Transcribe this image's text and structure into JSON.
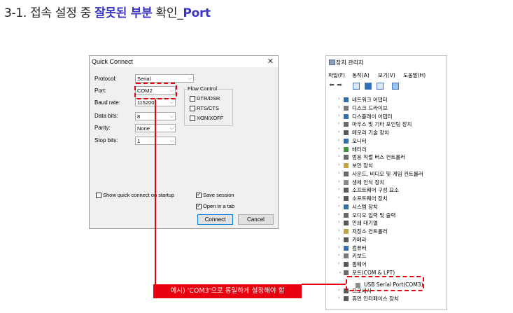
{
  "slide": {
    "title_prefix": "3-1. 접속 설정 중 ",
    "title_highlight": "잘못된 부분",
    "title_mid": " 확인_",
    "title_port": "Port"
  },
  "quick_connect": {
    "title": "Quick Connect",
    "close": "✕",
    "fields": [
      {
        "label": "Protocol:",
        "value": "Serial"
      },
      {
        "label": "Port:",
        "value": "COM2"
      },
      {
        "label": "Baud rate:",
        "value": "115200"
      },
      {
        "label": "Data bits:",
        "value": "8"
      },
      {
        "label": "Parity:",
        "value": "None"
      },
      {
        "label": "Stop bits:",
        "value": "1"
      }
    ],
    "flow_control": {
      "legend": "Flow Control",
      "options": [
        {
          "label": "DTR/DSR",
          "checked": false
        },
        {
          "label": "RTS/CTS",
          "checked": false
        },
        {
          "label": "XON/XOFF",
          "checked": false
        }
      ]
    },
    "show_on_startup": {
      "label": "Show quick connect on startup",
      "checked": false
    },
    "save_session": {
      "label": "Save session",
      "checked": true
    },
    "open_in_tab": {
      "label": "Open in a tab",
      "checked": true
    },
    "connect_label": "Connect",
    "cancel_label": "Cancel"
  },
  "device_manager": {
    "title": "장치 관리자",
    "menu": [
      "파일(F)",
      "동작(A)",
      "보기(V)",
      "도움말(H)"
    ],
    "items": [
      {
        "label": "네트워크 어댑터",
        "icon": "network-icon",
        "color": "#2f6fb7"
      },
      {
        "label": "디스크 드라이브",
        "icon": "disk-icon",
        "color": "#7a7a7a"
      },
      {
        "label": "디스플레이 어댑터",
        "icon": "display-icon",
        "color": "#2f6fb7"
      },
      {
        "label": "마우스 및 기타 포인팅 장치",
        "icon": "mouse-icon",
        "color": "#6a6a6a"
      },
      {
        "label": "메모리 기술 장치",
        "icon": "memory-icon",
        "color": "#5a5a5a"
      },
      {
        "label": "모니터",
        "icon": "monitor-icon",
        "color": "#2f6fb7"
      },
      {
        "label": "배터리",
        "icon": "battery-icon",
        "color": "#3c9a3c"
      },
      {
        "label": "범용 직렬 버스 컨트롤러",
        "icon": "usb-icon",
        "color": "#6a6a6a"
      },
      {
        "label": "보안 장치",
        "icon": "security-icon",
        "color": "#c8a23c"
      },
      {
        "label": "사운드, 비디오 및 게임 컨트롤러",
        "icon": "sound-icon",
        "color": "#6a6a6a"
      },
      {
        "label": "생체 인식 장치",
        "icon": "biometric-icon",
        "color": "#8a8a8a"
      },
      {
        "label": "소프트웨어 구성 요소",
        "icon": "software-component-icon",
        "color": "#5a5a5a"
      },
      {
        "label": "소프트웨어 장치",
        "icon": "software-device-icon",
        "color": "#5a5a5a"
      },
      {
        "label": "시스템 장치",
        "icon": "system-icon",
        "color": "#2f6fb7"
      },
      {
        "label": "오디오 입력 및 출력",
        "icon": "audio-icon",
        "color": "#6a6a6a"
      },
      {
        "label": "인쇄 대기열",
        "icon": "printer-icon",
        "color": "#5a5a5a"
      },
      {
        "label": "저장소 컨트롤러",
        "icon": "storage-icon",
        "color": "#c8a23c"
      },
      {
        "label": "카메라",
        "icon": "camera-icon",
        "color": "#5a5a5a"
      },
      {
        "label": "컴퓨터",
        "icon": "computer-icon",
        "color": "#2f6fb7"
      },
      {
        "label": "키보드",
        "icon": "keyboard-icon",
        "color": "#7a7a7a"
      },
      {
        "label": "펌웨어",
        "icon": "firmware-icon",
        "color": "#5a5a5a"
      },
      {
        "label": "포트(COM & LPT)",
        "icon": "port-icon",
        "color": "#6a6a6a"
      },
      {
        "label": "프로세서",
        "icon": "processor-icon",
        "color": "#5a5a5a"
      },
      {
        "label": "휴먼 인터페이스 장치",
        "icon": "hid-icon",
        "color": "#5a5a5a"
      }
    ],
    "sub_item": "USB Serial Port(COM3)"
  },
  "annotation": {
    "note": "예시) 'COM3'으로 동일하게 설정해야 함",
    "color": "#e8000f"
  }
}
